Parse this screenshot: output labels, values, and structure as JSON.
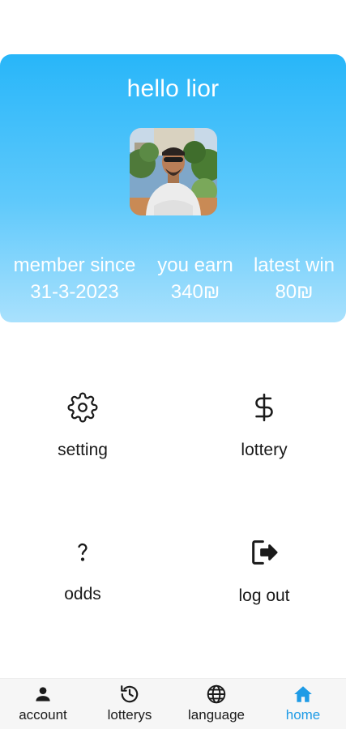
{
  "profile": {
    "greeting": "hello lior",
    "stats": [
      {
        "label": "member since",
        "value": "31-3-2023"
      },
      {
        "label": "you earn",
        "value": "340₪"
      },
      {
        "label": "latest win",
        "value": "80₪"
      }
    ]
  },
  "menu": [
    {
      "label": "setting",
      "icon": "gear-icon"
    },
    {
      "label": "lottery",
      "icon": "dollar-icon"
    },
    {
      "label": "odds",
      "icon": "question-icon"
    },
    {
      "label": "log out",
      "icon": "logout-icon"
    }
  ],
  "bottom_nav": {
    "active": "home",
    "items": [
      {
        "label": "account",
        "icon": "person-icon"
      },
      {
        "label": "lotterys",
        "icon": "history-icon"
      },
      {
        "label": "language",
        "icon": "globe-icon"
      },
      {
        "label": "home",
        "icon": "home-icon"
      }
    ]
  },
  "colors": {
    "card_top": "#28b6f9",
    "card_bottom": "#a9e1fd",
    "nav_active": "#1e9be6",
    "text": "#1a1a1a"
  }
}
